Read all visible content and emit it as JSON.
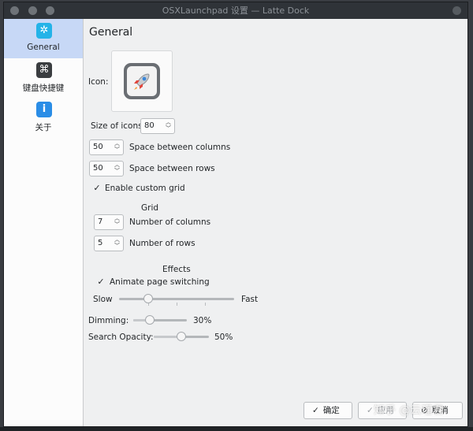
{
  "window": {
    "title": "OSXLaunchpad 设置 — Latte Dock"
  },
  "sidebar": {
    "items": [
      {
        "label": "General",
        "icon": "kde-gear-icon",
        "icon_glyph": "✲",
        "color": "#24b3e8"
      },
      {
        "label": "键盘快捷键",
        "icon": "command-key-icon",
        "icon_glyph": "⌘",
        "color": "#3a3d40"
      },
      {
        "label": "关于",
        "icon": "info-icon",
        "icon_glyph": "i",
        "color": "#2a8de6"
      }
    ]
  },
  "general": {
    "title": "General",
    "icon_label": "Icon:",
    "size_of_icons_label": "Size of icons",
    "size_of_icons_value": "80",
    "space_columns_value": "50",
    "space_columns_label": "Space between columns",
    "space_rows_value": "50",
    "space_rows_label": "Space between rows",
    "enable_custom_grid_label": "Enable custom grid",
    "enable_custom_grid_checked": true,
    "grid_heading": "Grid",
    "columns_value": "7",
    "columns_label": "Number of columns",
    "rows_value": "5",
    "rows_label": "Number of rows",
    "effects_heading": "Effects",
    "animate_label": "Animate page switching",
    "animate_checked": true,
    "speed_slow_label": "Slow",
    "speed_fast_label": "Fast",
    "speed_position": 0.25,
    "dimming_label": "Dimming:",
    "dimming_value": "30%",
    "search_opacity_label": "Search Opacity:",
    "search_opacity_value": "50%"
  },
  "buttons": {
    "ok": "确定",
    "apply": "应用",
    "cancel": "取消"
  },
  "watermark": "知乎 @云瑾君"
}
